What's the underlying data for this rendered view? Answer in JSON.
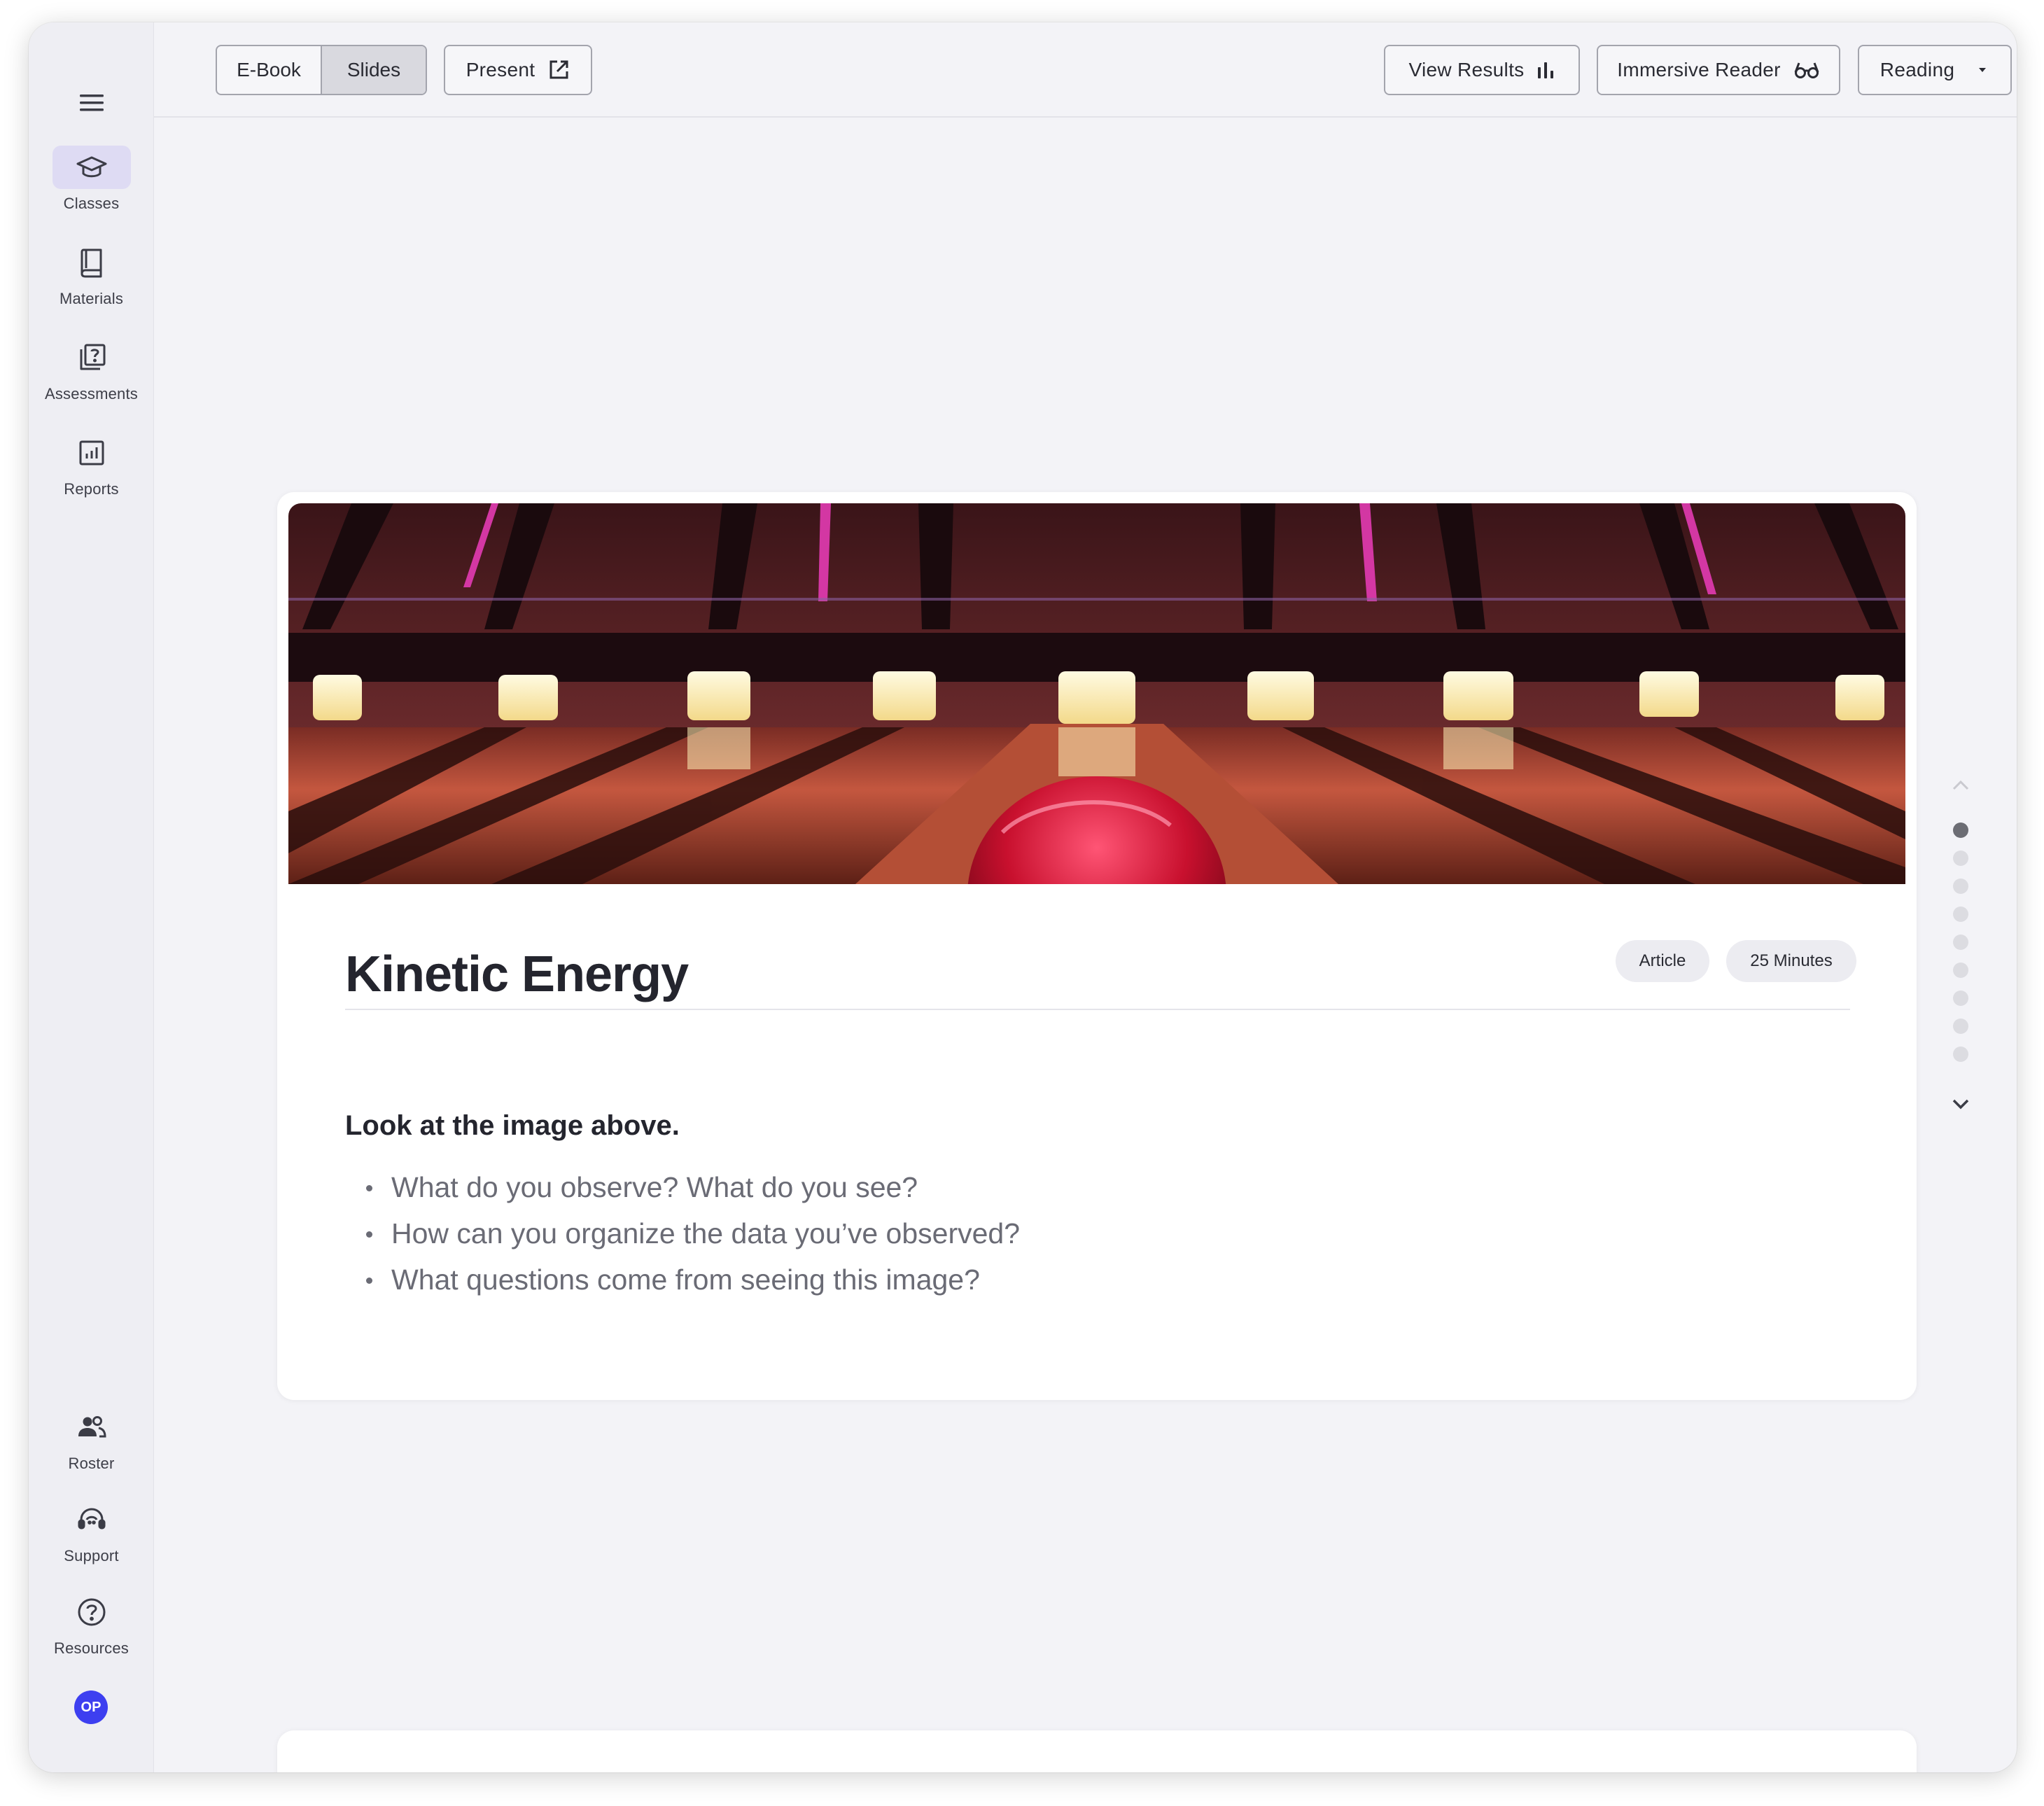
{
  "sidebar": {
    "items": [
      {
        "label": "Classes",
        "icon": "graduation-cap-icon",
        "active": true
      },
      {
        "label": "Materials",
        "icon": "book-icon"
      },
      {
        "label": "Assessments",
        "icon": "question-stack-icon"
      },
      {
        "label": "Reports",
        "icon": "report-chart-icon"
      }
    ],
    "bottom_items": [
      {
        "label": "Roster",
        "icon": "people-icon"
      },
      {
        "label": "Support",
        "icon": "headset-icon"
      },
      {
        "label": "Resources",
        "icon": "help-circle-icon"
      }
    ],
    "avatar_initials": "OP",
    "avatar_color": "#3d3ff0",
    "active_bg": "#dedbf3"
  },
  "toolbar": {
    "ebook_label": "E-Book",
    "slides_label": "Slides",
    "active_view": "Slides",
    "present_label": "Present",
    "view_results_label": "View Results",
    "immersive_reader_label": "Immersive Reader",
    "reading_label": "Reading"
  },
  "slide": {
    "title": "Kinetic Energy",
    "tags": [
      "Article",
      "25 Minutes"
    ],
    "prompt": "Look at the image above.",
    "questions": [
      "What do you observe? What do you see?",
      "How can you organize the data you’ve observed?",
      "What questions come from seeing this image?"
    ]
  },
  "pager": {
    "total": 9,
    "current": 1
  }
}
